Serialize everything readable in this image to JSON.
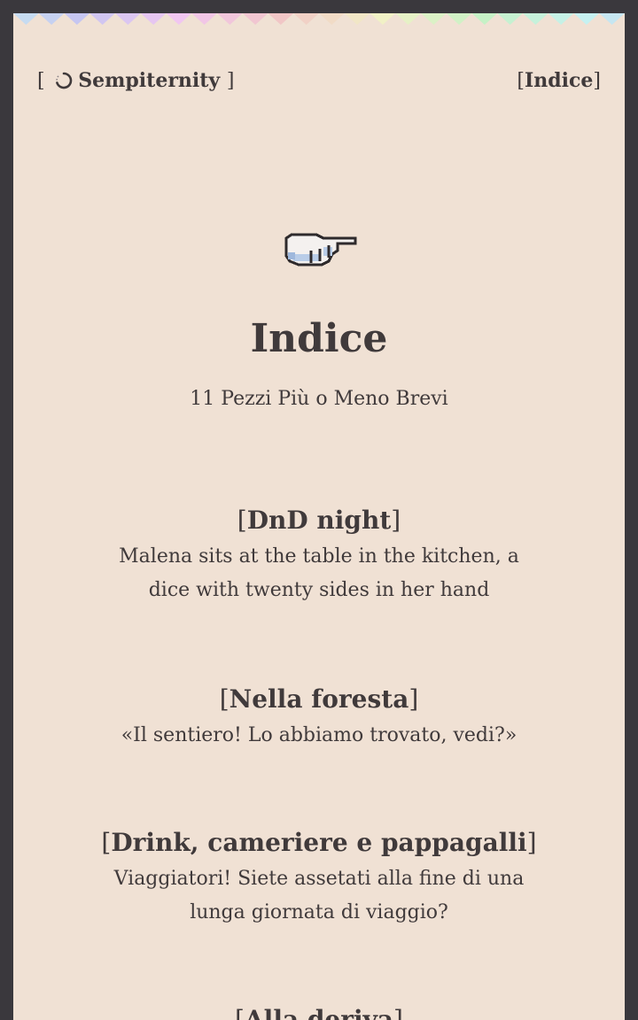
{
  "header": {
    "site_title": "Sempiternity",
    "nav_link": "Indice",
    "spinner_icon": "loading-spinner-icon"
  },
  "hero": {
    "icon": "pointing-hand-icon",
    "title": "Indice",
    "subtitle": "11 Pezzi Più o Meno Brevi"
  },
  "entries": [
    {
      "title": "DnD night",
      "excerpt": "Malena sits at the table in the kitchen, a dice with twenty sides in her hand"
    },
    {
      "title": "Nella foresta",
      "excerpt": "«Il sentiero! Lo abbiamo trovato, vedi?»"
    },
    {
      "title": "Drink, cameriere e pappagalli",
      "excerpt": "Viaggiatori! Siete assetati alla fine di una lunga giornata di viaggio?"
    },
    {
      "title": "Alla deriva",
      "excerpt": ""
    }
  ],
  "colors": {
    "page_background": "#f0e1d4",
    "frame": "#3a383d",
    "text": "#403a3b"
  }
}
